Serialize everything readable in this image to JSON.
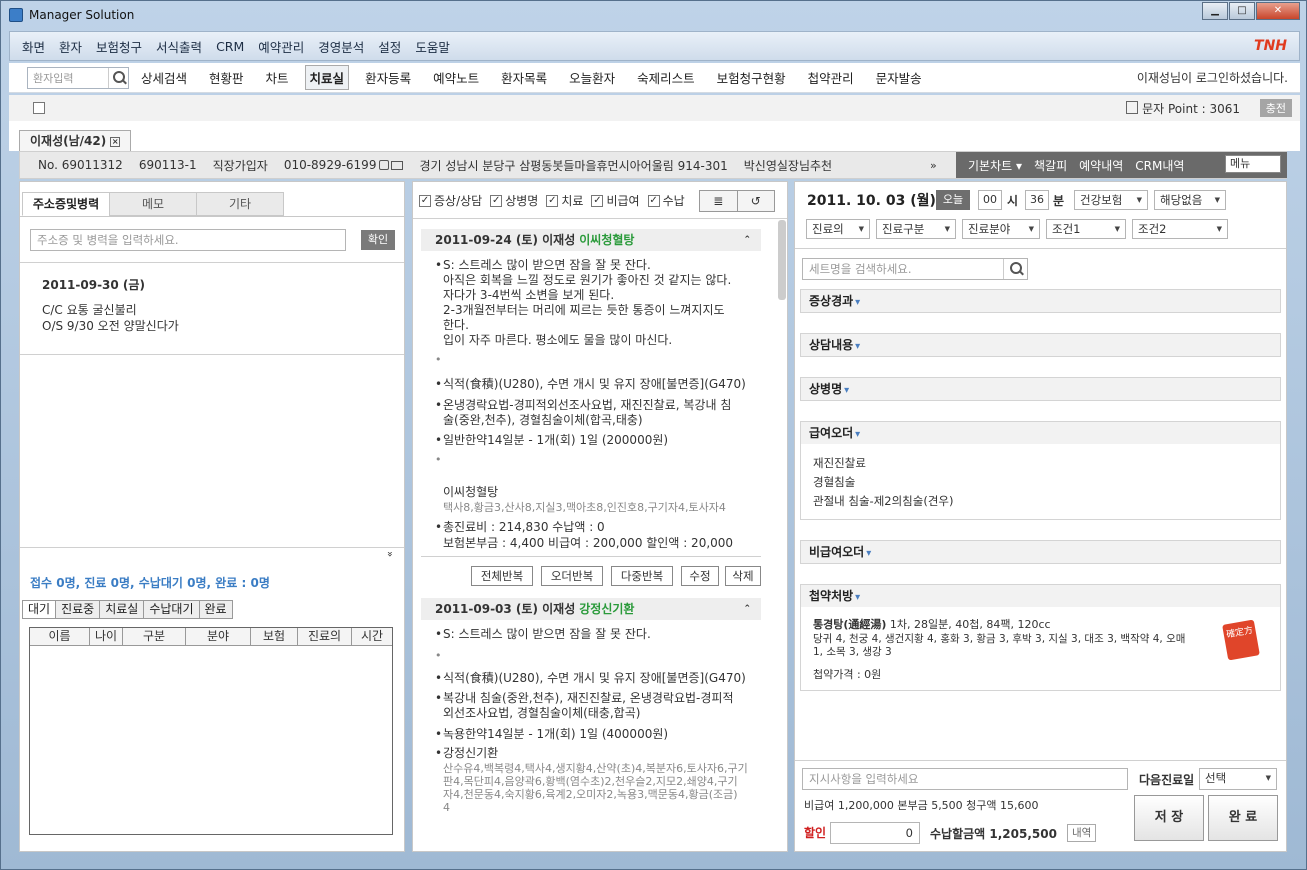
{
  "window": {
    "title": "Manager Solution",
    "min": "▁",
    "max": "□",
    "close": "✕"
  },
  "menu": {
    "items": [
      "화면",
      "환자",
      "보험청구",
      "서식출력",
      "CRM",
      "예약관리",
      "경영분석",
      "설정",
      "도움말"
    ],
    "logo": "TNH"
  },
  "toolbar": {
    "search_placeholder": "환자입력",
    "items": [
      "상세검색",
      "현황판",
      "차트"
    ],
    "active": "치료실",
    "items2": [
      "환자등록",
      "예약노트",
      "환자목록",
      "오늘환자",
      "숙제리스트",
      "보험청구현황",
      "첩약관리",
      "문자발송"
    ],
    "login": "이재성님이 로그인하셨습니다."
  },
  "sms": {
    "points": "문자 Point : 3061",
    "charge": "충전"
  },
  "patient": {
    "tab": "이재성(남/42)",
    "close": "×",
    "no": "No. 69011312",
    "birth": "690113-1",
    "type": "직장가입자",
    "phone": "010-8929-6199",
    "address": "경기 성남시 분당구 삼평동봇들마을휴먼시아어울림 914-301",
    "referral": "박신영실장님추천",
    "more": "»"
  },
  "chartnav": {
    "items": [
      "기본차트 ▾",
      "책갈피",
      "예약내역",
      "CRM내역"
    ],
    "menu": "메뉴"
  },
  "left": {
    "tabs": [
      "주소증및병력",
      "메모",
      "기타"
    ],
    "input_placeholder": "주소증 및 병력을 입력하세요.",
    "confirm": "확인",
    "date": "2011-09-30 (금)",
    "lines": [
      "C/C 요통 굴신불리",
      "O/S 9/30 오전 양말신다가"
    ],
    "expand": "»",
    "status": "접수 0명, 진료 0명, 수납대기 0명, 완료 : 0명",
    "wtabs": [
      "대기",
      "진료중",
      "치료실",
      "수납대기",
      "완료"
    ],
    "cols": [
      "이름",
      "나이",
      "구분",
      "분야",
      "보험",
      "진료의",
      "시간"
    ]
  },
  "mid": {
    "filters": [
      "증상/상담",
      "상병명",
      "치료",
      "비급여",
      "수납"
    ],
    "viewicons": [
      "≣",
      "↺"
    ],
    "rec1": {
      "header": "2011-09-24 (토) 이재성",
      "herb": "이씨청혈탕",
      "up": "⌃",
      "s": [
        "S: 스트레스 많이 받으면 잠을 잘 못 잔다.",
        "아직은 회복을 느낄 정도로 원기가 좋아진 것 같지는 않다.",
        "자다가 3-4번씩 소변을 보게 된다.",
        "2-3개월전부터는 머리에 찌르는 듯한 통증이 느껴지지도",
        "한다.",
        "입이 자주 마른다. 평소에도 물을 많이 마신다."
      ],
      "dx": "식적(食積)(U280), 수면 개시 및 유지 장애[불면증](G470)",
      "tx1": "온냉경락요법-경피적외선조사요법, 재진진찰료, 복강내 침",
      "tx2": "술(중완,천추), 경혈침술이체(합곡,태충)",
      "med": "일반한약14일분 - 1개(회) 1일 (200000원)",
      "herbdetail": "택사8,황금3,산사8,지실3,맥아초8,인진호8,구기자4,토사자4",
      "fee1": "총진료비 : 214,830    수납액 : 0",
      "fee2": "보험본부금 : 4,400    비급여 : 200,000    할인액 : 20,000",
      "bullet": "•"
    },
    "actions": [
      "전체반복",
      "오더반복",
      "다중반복",
      "수정",
      "삭제"
    ],
    "rec2": {
      "header": "2011-09-03 (토) 이재성",
      "herb": "강정신기환",
      "up": "⌃",
      "s": "S: 스트레스 많이 받으면 잠을 잘 못 잔다.",
      "dx": "식적(食積)(U280), 수면 개시 및 유지 장애[불면증](G470)",
      "tx1": "복강내 침술(중완,천추), 재진진찰료, 온냉경락요법-경피적",
      "tx2": "외선조사요법, 경혈침술이체(태충,합곡)",
      "med": "녹용한약14일분 - 1개(회) 1일 (400000원)",
      "hd1": "산수유4,백복령4,택사4,생지황4,산약(초)4,복분자6,토사자6,구기",
      "hd2": "판4,목단피4,음양곽6,황백(염수초)2,천우슬2,지모2,쇄양4,구기",
      "hd3": "자4,천문동4,숙지황6,육계2,오미자2,녹용3,맥문동4,황금(조금)",
      "hd4": "4"
    }
  },
  "right": {
    "date": "2011. 10. 03 (월)",
    "today": "오늘",
    "hour": "00",
    "hlabel": "시",
    "min": "36",
    "mlabel": "분",
    "ins": "건강보험",
    "none": "해당없음",
    "doc": "진료의",
    "kind": "진료구분",
    "field": "진료분야",
    "cond1": "조건1",
    "cond2": "조건2",
    "set_placeholder": "세트명을 검색하세요.",
    "sections": [
      "증상경과",
      "상담내용",
      "상병명",
      "급여오더",
      "비급여오더",
      "첩약처방"
    ],
    "chev": "≫",
    "orders": [
      "재진진찰료",
      "경혈침술",
      "관절내 침술-제2의침술(견우)"
    ],
    "rx_name": "통경탕(通經湯)",
    "rx_spec": "1차, 28일분, 40첩, 84팩, 120cc",
    "rx1": "당귀 4, 천궁 4, 생건지황 4, 홍화 3, 황금 3, 후박 3, 지실 3, 대조 3, 백작약 4, 오매",
    "rx2": "1, 소목 3, 생강 3",
    "rx_price": "첩약가격 : 0원",
    "stamp": "確定方",
    "note_placeholder": "지시사항을 입력하세요",
    "next": "다음진료일",
    "next_sel": "선택",
    "fees": "비급여 1,200,000  본부금 5,500  청구액 15,600",
    "disc": "할인",
    "disc_val": "0",
    "pay": "수납할금액 1,205,500",
    "detail": "내역",
    "save": "저 장",
    "done": "완 료"
  }
}
